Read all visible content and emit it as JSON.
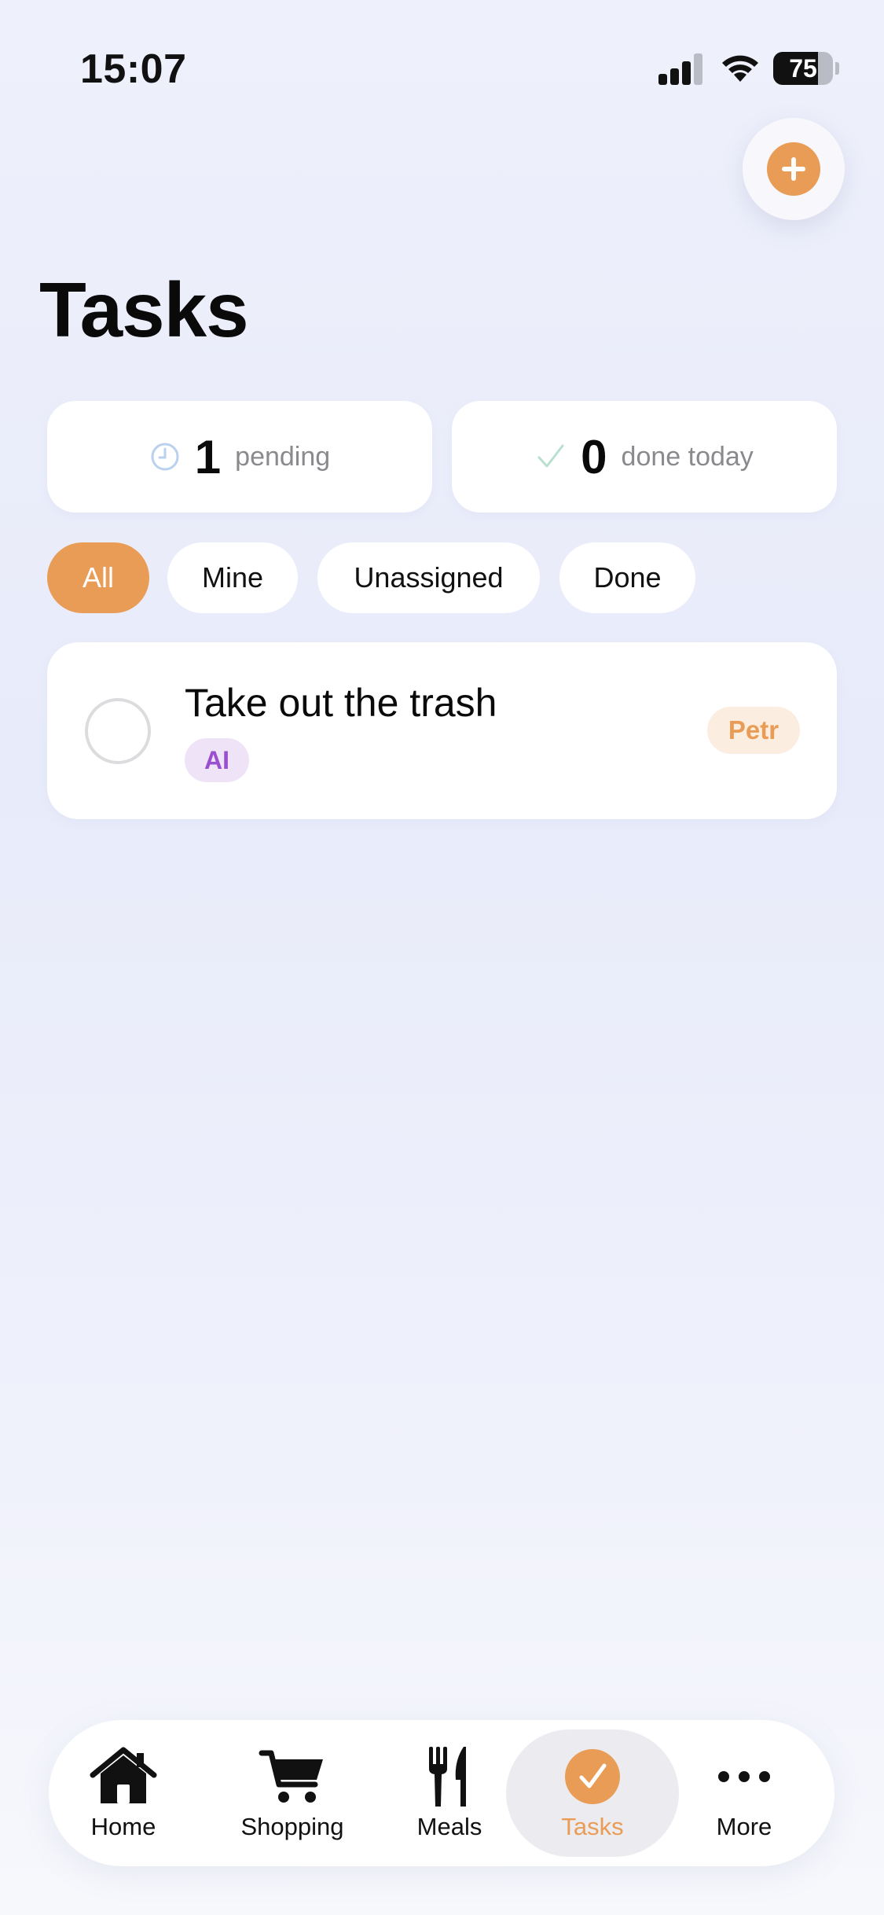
{
  "status_bar": {
    "time": "15:07",
    "battery_level": "75"
  },
  "header": {
    "title": "Tasks",
    "add_icon": "plus-icon"
  },
  "stats": {
    "pending": {
      "icon": "clock-icon",
      "count": "1",
      "label": "pending"
    },
    "done": {
      "icon": "check-icon",
      "count": "0",
      "label": "done today"
    }
  },
  "filters": {
    "active": "All",
    "items": [
      "All",
      "Mine",
      "Unassigned",
      "Done"
    ]
  },
  "tasks": [
    {
      "title": "Take out the trash",
      "tag": "AI",
      "assignee": "Petr",
      "completed": false
    }
  ],
  "tab_bar": {
    "active": "Tasks",
    "items": [
      {
        "label": "Home",
        "icon": "home-icon"
      },
      {
        "label": "Shopping",
        "icon": "cart-icon"
      },
      {
        "label": "Meals",
        "icon": "fork-knife-icon"
      },
      {
        "label": "Tasks",
        "icon": "check-circle-icon"
      },
      {
        "label": "More",
        "icon": "ellipsis-icon"
      }
    ]
  },
  "colors": {
    "accent": "#e99c55",
    "tag_bg": "#efe3f8",
    "tag_text": "#9a4fd0",
    "assignee_bg": "#fbeee0"
  }
}
